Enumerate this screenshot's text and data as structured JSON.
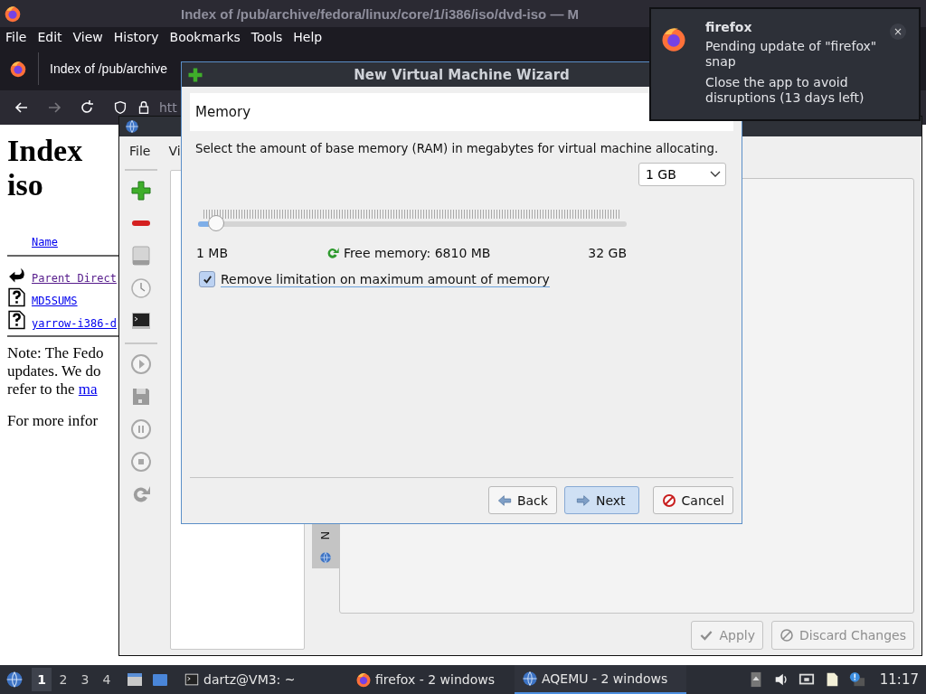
{
  "firefox": {
    "title": "Index of /pub/archive/fedora/linux/core/1/i386/iso/dvd-iso — M",
    "menu": [
      {
        "label": "File"
      },
      {
        "label": "Edit"
      },
      {
        "label": "View"
      },
      {
        "label": "History"
      },
      {
        "label": "Bookmarks"
      },
      {
        "label": "Tools"
      },
      {
        "label": "Help"
      }
    ],
    "tab": "Index of /pub/archive",
    "url": "htt",
    "page": {
      "heading": [
        "Index",
        "iso"
      ],
      "column": "Name",
      "entries": [
        {
          "kind": "parent",
          "name": "Parent Direct"
        },
        {
          "kind": "file",
          "name": "MD5SUMS"
        },
        {
          "kind": "file",
          "name": "yarrow-i386-d"
        }
      ],
      "note": [
        "Note: The Fedo",
        "updates. We do"
      ],
      "note_end": "refer to the",
      "note_link": "ma",
      "more": "For more infor"
    }
  },
  "aqemu": {
    "menu": [
      "File",
      "Vi"
    ],
    "side_tab": "N",
    "buttons": [
      {
        "kind": "apply",
        "label": "Apply",
        "disabled": true
      },
      {
        "kind": "discard",
        "label": "Discard Changes",
        "disabled": true
      }
    ]
  },
  "wizard": {
    "title": "New Virtual Machine Wizard",
    "page_title": "Memory",
    "prompt": "Select the amount of base memory (RAM) in megabytes for virtual machine allocating.",
    "size": "1 GB",
    "slider": {
      "level": 0.03
    },
    "min": "1 MB",
    "free": "Free memory: 6810 MB",
    "max": "32 GB",
    "remove_limit": {
      "label": "Remove limitation on maximum amount of memory",
      "checked": true
    },
    "buttons": [
      {
        "kind": "back",
        "label": "Back",
        "default": false
      },
      {
        "kind": "next",
        "label": "Next",
        "default": true
      },
      {
        "kind": "cancel",
        "label": "Cancel",
        "default": false
      }
    ]
  },
  "notification": {
    "app": "firefox",
    "lines": [
      "Pending update of \"firefox\" snap",
      "Close the app to avoid disruptions (13 days left)"
    ],
    "close": "×"
  },
  "taskbar": {
    "workspaces": [
      {
        "label": "1",
        "selected": true
      },
      {
        "label": "2",
        "selected": false
      },
      {
        "label": "3",
        "selected": false
      },
      {
        "label": "4",
        "selected": false
      }
    ],
    "tasks": [
      {
        "kind": "terminal",
        "label": "dartz@VM3: ~",
        "selected": false
      },
      {
        "kind": "firefox",
        "label": "firefox - 2 windows",
        "selected": false
      },
      {
        "kind": "aqemu",
        "label": "AQEMU - 2 windows",
        "selected": true
      }
    ],
    "clock": "11:17"
  }
}
